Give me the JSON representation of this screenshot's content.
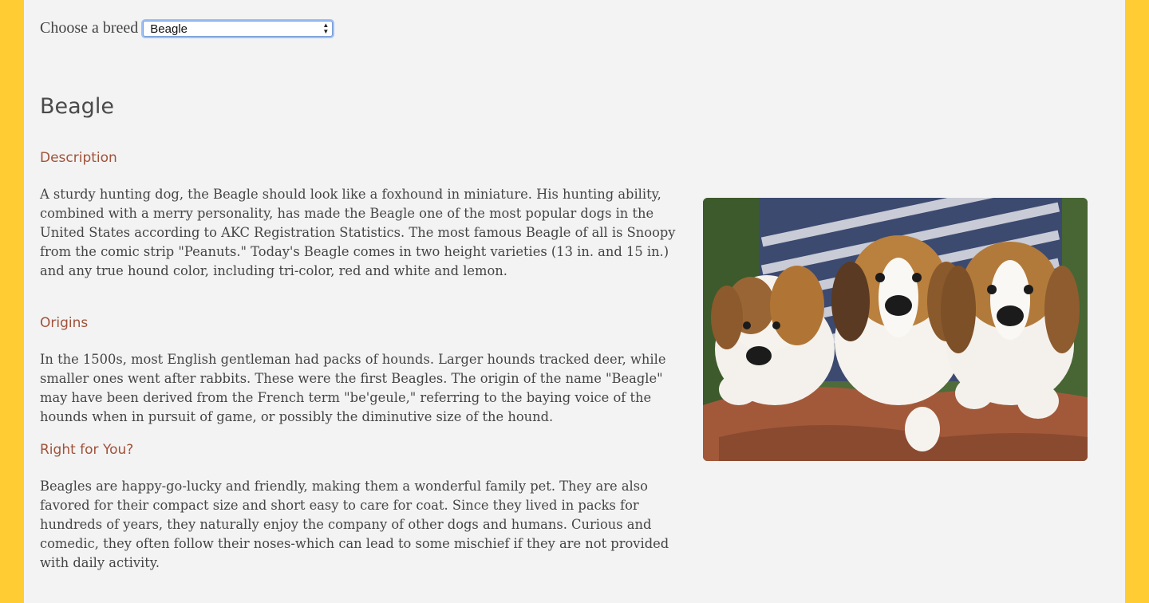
{
  "chooser": {
    "label": "Choose a breed",
    "selected": "Beagle"
  },
  "breed": {
    "name": "Beagle",
    "sections": [
      {
        "heading": "Description",
        "text": "A sturdy hunting dog, the Beagle should look like a foxhound in miniature. His hunting ability, combined with a merry personality, has made the Beagle one of the most popular dogs in the United States according to AKC Registration Statistics. The most famous Beagle of all is Snoopy from the comic strip \"Peanuts.\" Today's Beagle comes in two height varieties (13 in. and 15 in.) and any true hound color, including tri-color, red and white and lemon."
      },
      {
        "heading": "Origins",
        "text": "In the 1500s, most English gentleman had packs of hounds. Larger hounds tracked deer, while smaller ones went after rabbits. These were the first Beagles. The origin of the name \"Beagle\" may have been derived from the French term \"be'geule,\" referring to the baying voice of the hounds when in pursuit of game, or possibly the diminutive size of the hound."
      },
      {
        "heading": "Right for You?",
        "text": "Beagles are happy-go-lucky and friendly, making them a wonderful family pet. They are also favored for their compact size and short easy to care for coat. Since they lived in packs for hundreds of years, they naturally enjoy the company of other dogs and humans. Curious and comedic, they often follow their noses-which can lead to some mischief if they are not provided with daily activity."
      }
    ]
  },
  "photo": {
    "subject": "three beagle puppies held in arms"
  },
  "colors": {
    "frame": "#ffcc33",
    "panel": "#f3f3f3",
    "heading": "#a0523a",
    "text": "#444444"
  }
}
